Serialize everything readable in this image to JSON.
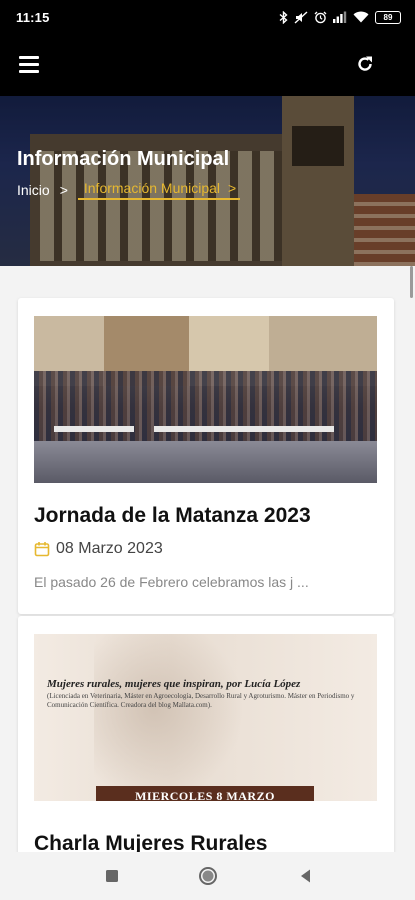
{
  "status_bar": {
    "time": "11:15",
    "battery": "89",
    "icons": [
      "bluetooth-icon",
      "mute-icon",
      "alarm-icon",
      "signal-icon",
      "wifi-icon",
      "battery-icon"
    ]
  },
  "app_bar": {
    "menu_icon": "hamburger-icon",
    "refresh_icon": "refresh-icon"
  },
  "hero": {
    "title": "Información Municipal",
    "breadcrumb": {
      "home": "Inicio",
      "separator": ">",
      "current": "Información Municipal",
      "current_suffix": ">"
    },
    "accent_color": "#e6b830"
  },
  "posts": [
    {
      "title": "Jornada de la Matanza 2023",
      "date": "08 Marzo 2023",
      "excerpt": "El pasado 26 de Febrero celebramos las j ..."
    },
    {
      "title": "Charla Mujeres Rurales",
      "poster": {
        "heading": "Mujeres rurales, mujeres que inspiran, por Lucía López",
        "subtitle": "(Licenciada en Veterinaria, Máster en Agroecología, Desarrollo Rural y Agroturismo. Máster en Periodismo y Comunicación Científica. Creadora del blog Mallata.com).",
        "band": "MIERCOLES 8 MARZO"
      }
    }
  ],
  "nav_bar": {
    "icons": [
      "recents-square-icon",
      "home-circle-icon",
      "back-triangle-icon"
    ]
  }
}
